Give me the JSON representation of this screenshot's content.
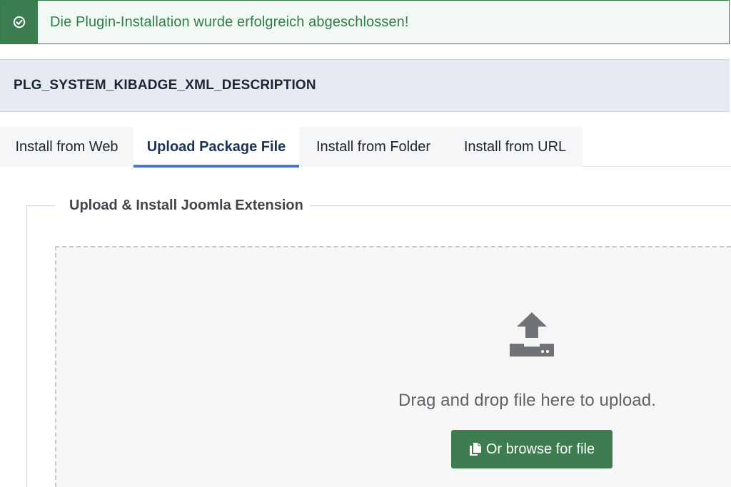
{
  "alert": {
    "message": "Die Plugin-Installation wurde erfolgreich abgeschlossen!",
    "icon": "check-circle-icon",
    "color": "#3b7d4f"
  },
  "plugin": {
    "description": "PLG_SYSTEM_KIBADGE_XML_DESCRIPTION"
  },
  "tabs": [
    {
      "label": "Install from Web"
    },
    {
      "label": "Upload Package File",
      "active": true
    },
    {
      "label": "Install from Folder"
    },
    {
      "label": "Install from URL"
    }
  ],
  "upload": {
    "legend": "Upload & Install Joomla Extension",
    "drop_text": "Drag and drop file here to upload.",
    "browse_label": "Or browse for file",
    "upload_icon": "upload-icon",
    "browse_icon": "copy-icon",
    "button_color": "#3d7d50"
  }
}
